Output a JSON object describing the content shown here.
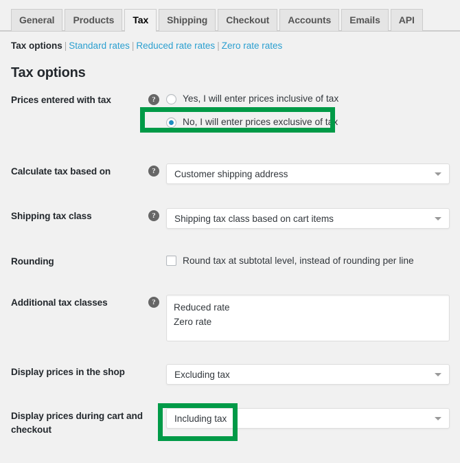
{
  "tabs": [
    {
      "label": "General",
      "active": false
    },
    {
      "label": "Products",
      "active": false
    },
    {
      "label": "Tax",
      "active": true
    },
    {
      "label": "Shipping",
      "active": false
    },
    {
      "label": "Checkout",
      "active": false
    },
    {
      "label": "Accounts",
      "active": false
    },
    {
      "label": "Emails",
      "active": false
    },
    {
      "label": "API",
      "active": false
    }
  ],
  "subnav": {
    "current": "Tax options",
    "links": [
      "Standard rates",
      "Reduced rate rates",
      "Zero rate rates"
    ],
    "separator": "|"
  },
  "page_title": "Tax options",
  "help_icon_glyph": "?",
  "help_icon_name": "help-tip-icon",
  "dropdown_icon_name": "chevron-down-icon",
  "rows": {
    "prices_entered_with_tax": {
      "label": "Prices entered with tax",
      "options": [
        {
          "label": "Yes, I will enter prices inclusive of tax",
          "checked": false
        },
        {
          "label": "No, I will enter prices exclusive of tax",
          "checked": true
        }
      ]
    },
    "calculate_tax_based_on": {
      "label": "Calculate tax based on",
      "value": "Customer shipping address"
    },
    "shipping_tax_class": {
      "label": "Shipping tax class",
      "value": "Shipping tax class based on cart items"
    },
    "rounding": {
      "label": "Rounding",
      "checkbox_label": "Round tax at subtotal level, instead of rounding per line",
      "checked": false
    },
    "additional_tax_classes": {
      "label": "Additional tax classes",
      "value": "Reduced rate\nZero rate"
    },
    "display_prices_in_shop": {
      "label": "Display prices in the shop",
      "value": "Excluding tax"
    },
    "display_prices_cart_checkout": {
      "label": "Display prices during cart and checkout",
      "value": "Including tax"
    }
  },
  "highlight_color": "#009a47"
}
